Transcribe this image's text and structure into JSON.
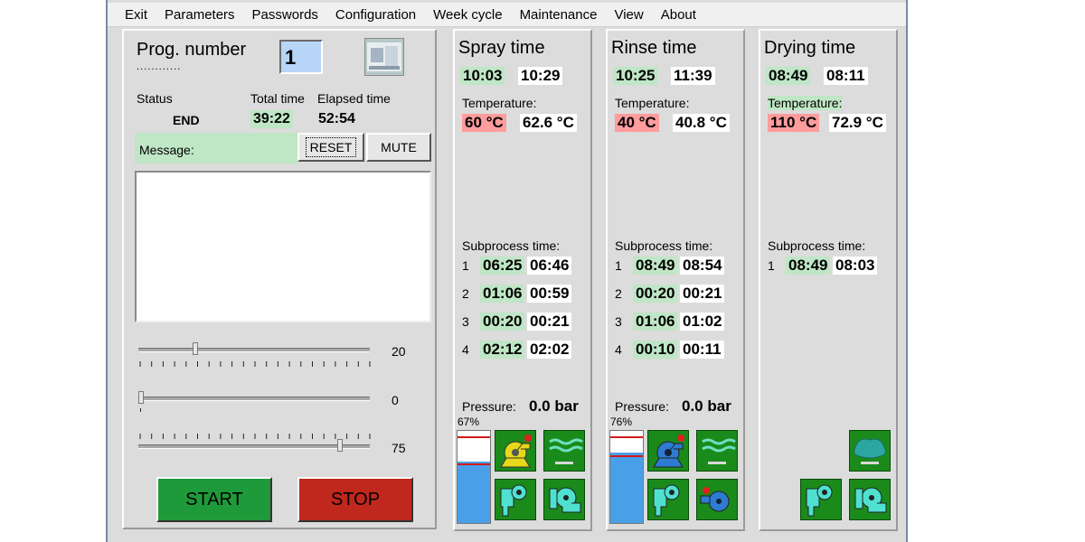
{
  "menu": [
    "Exit",
    "Parameters",
    "Passwords",
    "Configuration",
    "Week cycle",
    "Maintenance",
    "View",
    "About"
  ],
  "control": {
    "prog_label": "Prog. number",
    "prog_dots": ". . . . . . . . . . . .",
    "prog_value": "1",
    "status_label": "Status",
    "status_value": "END",
    "total_label": "Total time",
    "total_value": "39:22",
    "elapsed_label": "Elapsed time",
    "elapsed_value": "52:54",
    "message_label": "Message:",
    "reset_label": "RESET",
    "mute_label": "MUTE",
    "sliders": [
      {
        "value": 20,
        "label": "20"
      },
      {
        "value": 0,
        "label": "0"
      },
      {
        "value": 75,
        "label": "75"
      }
    ],
    "start_label": "START",
    "stop_label": "STOP",
    "start_color": "#1f9a3a",
    "stop_color": "#c0281e"
  },
  "phases": [
    {
      "title": "Spray time",
      "set_time": "10:03",
      "act_time": "10:29",
      "temp_label": "Temperature:",
      "temp_set": "60 °C",
      "temp_act": "62.6 °C",
      "sub_label": "Subprocess time:",
      "subs": [
        {
          "n": "1",
          "set": "06:25",
          "act": "06:46"
        },
        {
          "n": "2",
          "set": "01:06",
          "act": "00:59"
        },
        {
          "n": "3",
          "set": "00:20",
          "act": "00:21"
        },
        {
          "n": "4",
          "set": "02:12",
          "act": "02:02"
        }
      ],
      "pressure_label": "Pressure:",
      "pressure_value": "0.0 bar",
      "gauge_label": "67%",
      "gauge_level": 0.67,
      "icons": [
        "pump-yellow-icon",
        "water-tank-icon",
        "valve-icon",
        "pump-icon"
      ]
    },
    {
      "title": "Rinse time",
      "set_time": "10:25",
      "act_time": "11:39",
      "temp_label": "Temperature:",
      "temp_set": "40 °C",
      "temp_act": "40.8 °C",
      "sub_label": "Subprocess time:",
      "subs": [
        {
          "n": "1",
          "set": "08:49",
          "act": "08:54"
        },
        {
          "n": "2",
          "set": "00:20",
          "act": "00:21"
        },
        {
          "n": "3",
          "set": "01:06",
          "act": "01:02"
        },
        {
          "n": "4",
          "set": "00:10",
          "act": "00:11"
        }
      ],
      "pressure_label": "Pressure:",
      "pressure_value": "0.0 bar",
      "gauge_label": "76%",
      "gauge_level": 0.76,
      "icons": [
        "pump-blue-icon",
        "water-tank-icon",
        "valve-icon",
        "pump-blue-small-icon"
      ]
    },
    {
      "title": "Drying time",
      "set_time": "08:49",
      "act_time": "08:11",
      "temp_label": "Temperature:",
      "temp_set": "110 °C",
      "temp_act": "72.9 °C",
      "sub_label": "Subprocess time:",
      "subs": [
        {
          "n": "1",
          "set": "08:49",
          "act": "08:03"
        }
      ],
      "icons": [
        "dryer-icon",
        "valve-icon",
        "pump-icon"
      ]
    }
  ]
}
